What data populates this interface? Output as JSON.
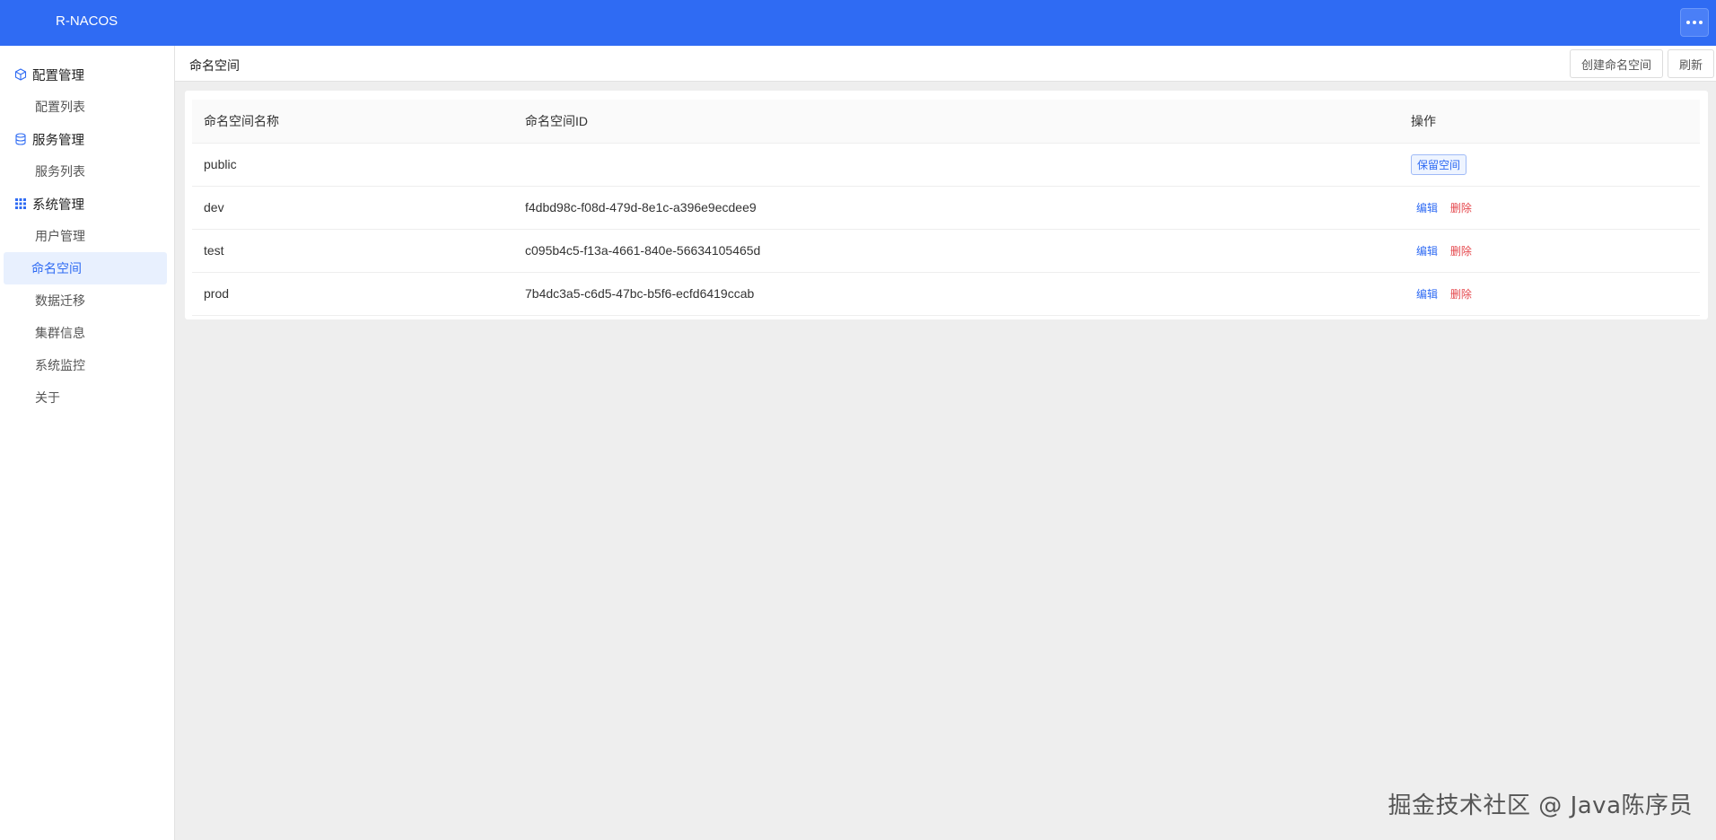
{
  "app": {
    "title": "R-NACOS"
  },
  "sidebar": {
    "groups": [
      {
        "label": "配置管理",
        "icon": "cube-icon",
        "items": [
          "配置列表"
        ]
      },
      {
        "label": "服务管理",
        "icon": "database-icon",
        "items": [
          "服务列表"
        ]
      },
      {
        "label": "系统管理",
        "icon": "grid-icon",
        "items": [
          "用户管理",
          "命名空间",
          "数据迁移",
          "集群信息",
          "系统监控",
          "关于"
        ]
      }
    ],
    "active_item": "命名空间"
  },
  "header": {
    "title": "命名空间",
    "create_label": "创建命名空间",
    "refresh_label": "刷新"
  },
  "table": {
    "columns": [
      "命名空间名称",
      "命名空间ID",
      "操作"
    ],
    "rows": [
      {
        "name": "public",
        "id": "",
        "reserved_label": "保留空间"
      },
      {
        "name": "dev",
        "id": "f4dbd98c-f08d-479d-8e1c-a396e9ecdee9",
        "edit_label": "编辑",
        "delete_label": "删除"
      },
      {
        "name": "test",
        "id": "c095b4c5-f13a-4661-840e-56634105465d",
        "edit_label": "编辑",
        "delete_label": "删除"
      },
      {
        "name": "prod",
        "id": "7b4dc3a5-c6d5-47bc-b5f6-ecfd6419ccab",
        "edit_label": "编辑",
        "delete_label": "删除"
      }
    ]
  },
  "watermark": "掘金技术社区 @ Java陈序员",
  "colors": {
    "primary": "#2f6bf3",
    "danger": "#e5484d"
  }
}
